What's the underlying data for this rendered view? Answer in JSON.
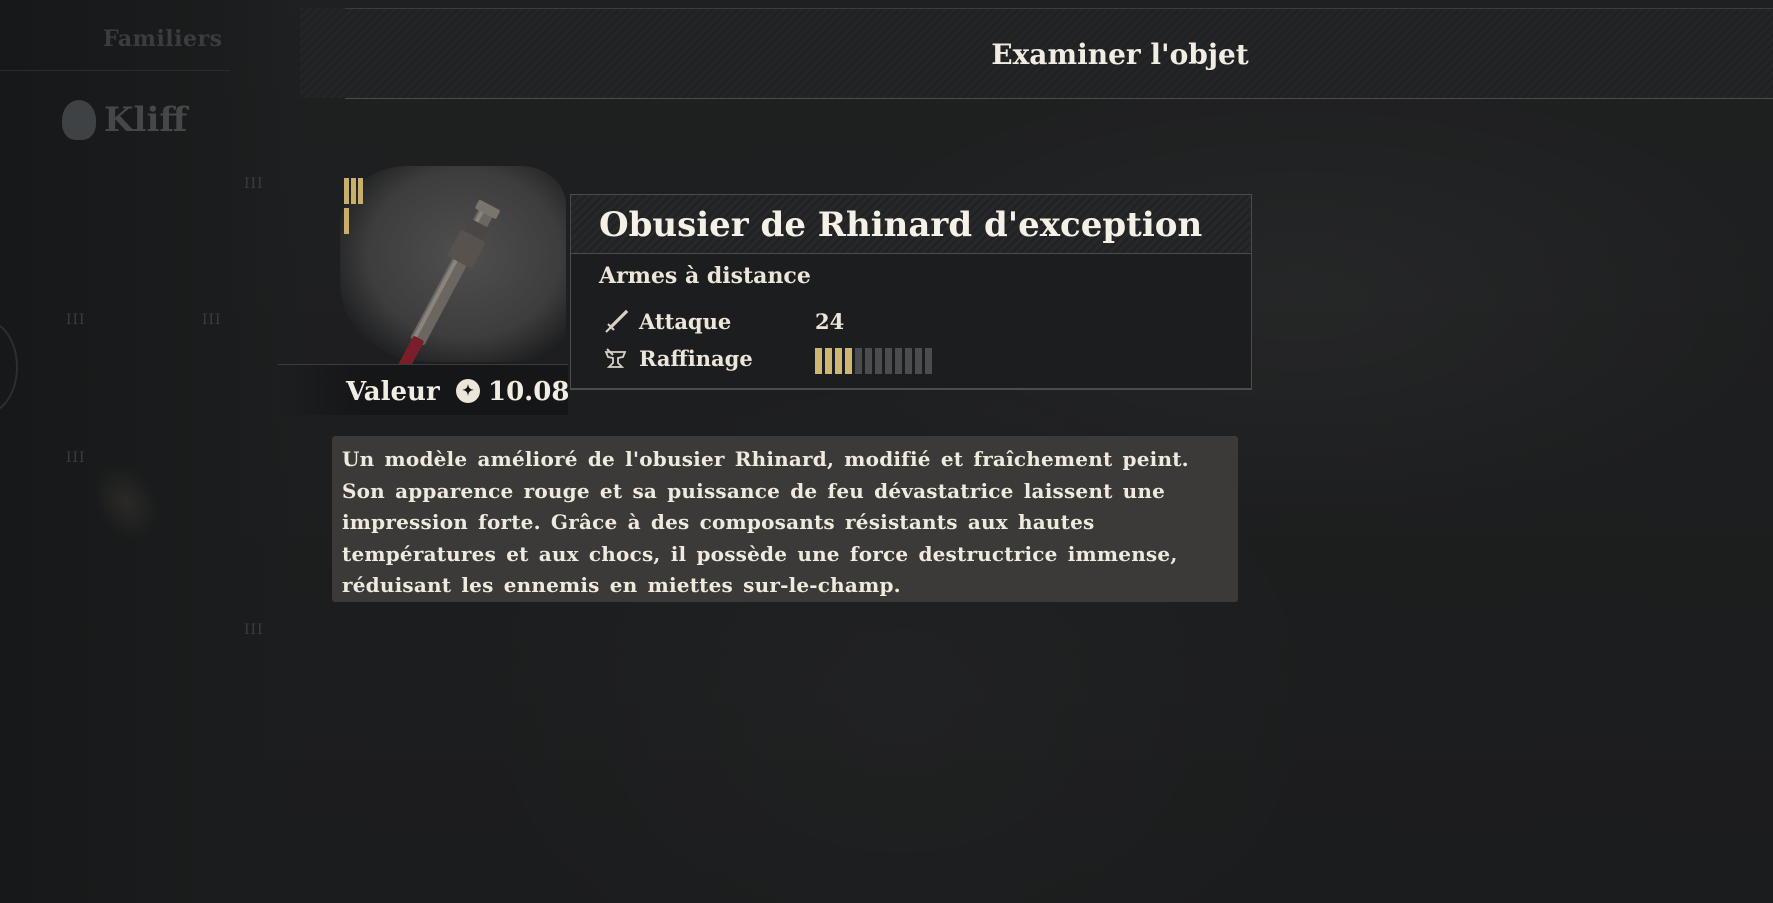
{
  "sidebar": {
    "tab_label": "Familiers",
    "character_name": "Kliff",
    "marks": "III"
  },
  "header": {
    "title": "Examiner l'objet"
  },
  "item": {
    "rarity_level": 3,
    "name": "Obusier de Rhinard d'exception",
    "category": "Armes à distance",
    "value_label": "Valeur",
    "value_amount": "10.08",
    "currency_icon": "coin-icon",
    "stats": [
      {
        "label": "Attaque",
        "icon": "sword-icon",
        "value": "24"
      },
      {
        "label": "Raffinage",
        "icon": "anvil-icon",
        "refine_level": 4,
        "refine_max": 12
      }
    ],
    "description": "Un modèle amélioré de l'obusier Rhinard, modifié et fraîchement peint. Son apparence rouge et sa puissance de feu dévastatrice laissent une impression forte. Grâce à des composants résistants aux hautes températures et aux chocs, il possède une force destructrice immense, réduisant les ennemis en miettes sur-le-champ."
  },
  "colors": {
    "accent_gold": "#cdb773",
    "panel_bg": "#1c1d1e",
    "desc_bg": "#3c3a38",
    "text": "#ece6da"
  }
}
